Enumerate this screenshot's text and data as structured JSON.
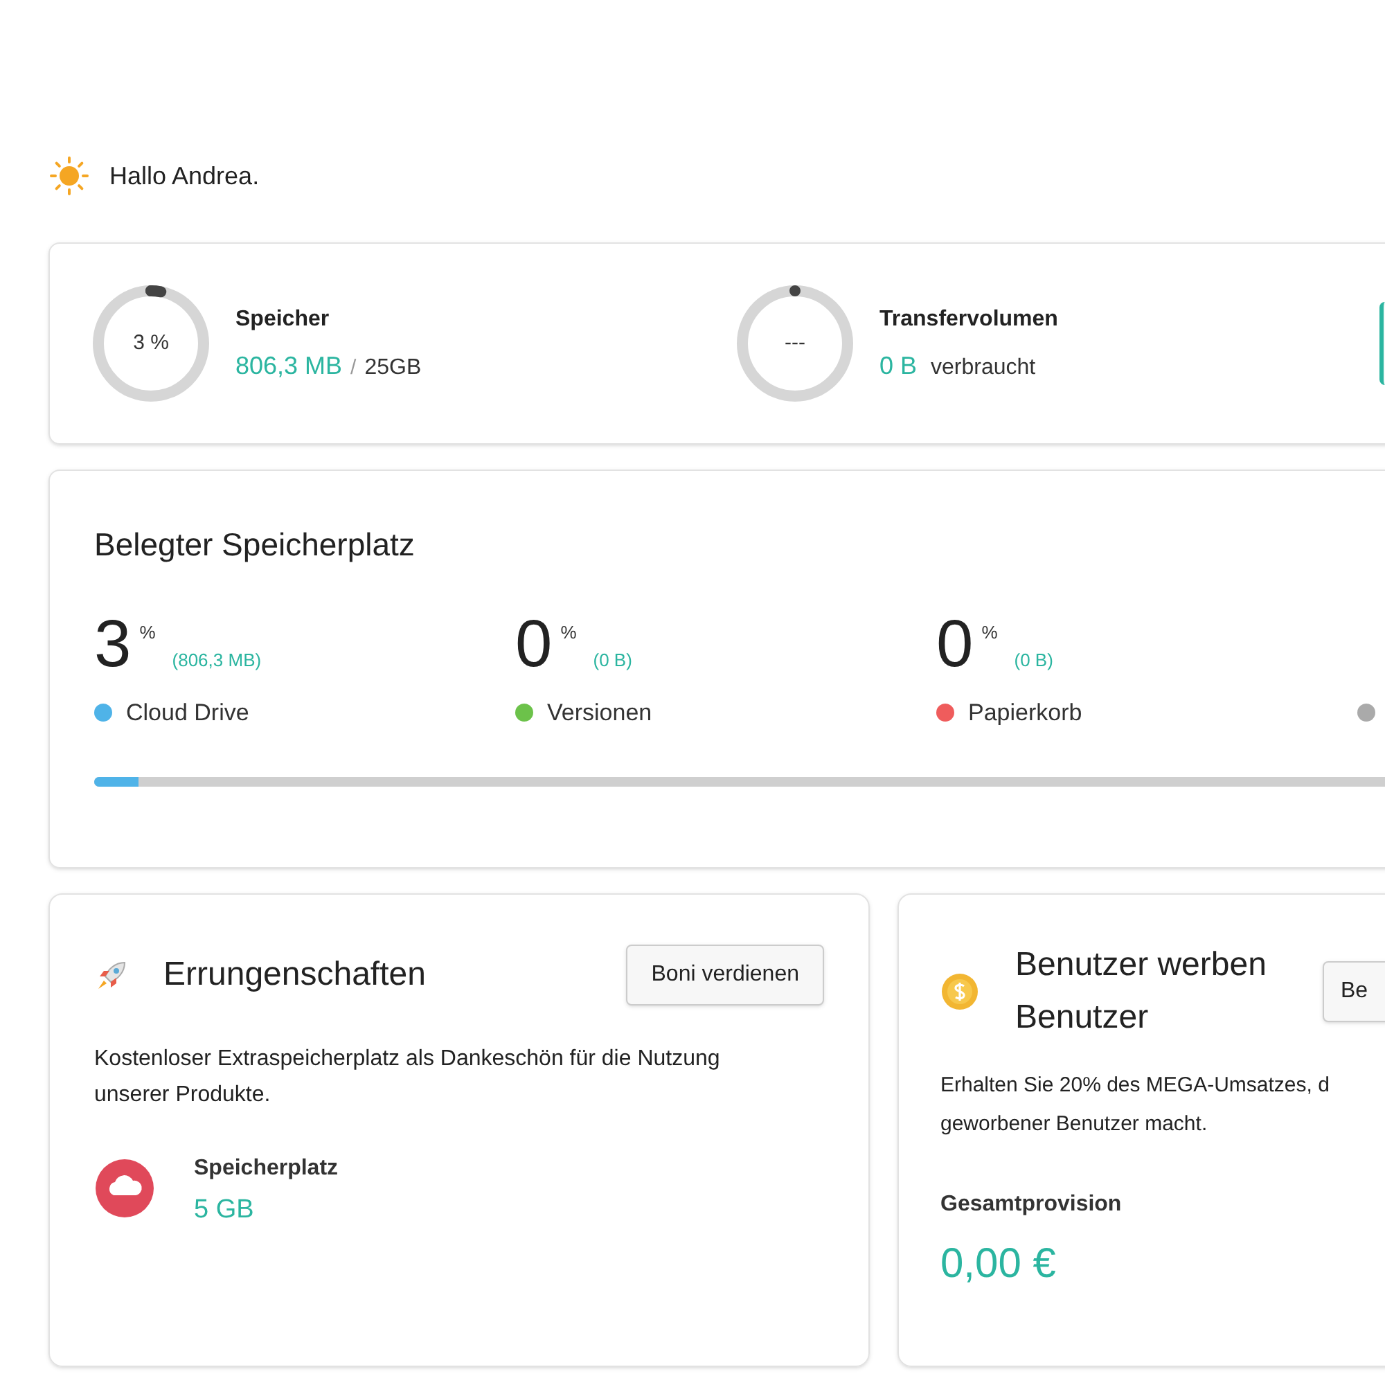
{
  "greeting": "Hallo Andrea.",
  "quota": [
    {
      "kind": "storage",
      "ring_text": "3 %",
      "level": 0.03,
      "title": "Speicher",
      "value": "806,3 MB",
      "separator": "/",
      "total": "25GB"
    },
    {
      "kind": "transfer",
      "ring_text": "---",
      "title": "Transfervolumen",
      "value": "0 B",
      "suffix": "verbraucht"
    }
  ],
  "usage": {
    "title": "Belegter Speicherplatz",
    "stats": [
      {
        "value": "3",
        "unit": "%",
        "detail": "(806,3 MB)",
        "label": "Cloud Drive",
        "color": "#4fb3e8",
        "level": 0.03
      },
      {
        "value": "0",
        "unit": "%",
        "detail": "(0 B)",
        "label": "Versionen",
        "color": "#6cc24a"
      },
      {
        "value": "0",
        "unit": "%",
        "detail": "(0 B)",
        "label": "Papierkorb",
        "color": "#ef5c5c"
      },
      {
        "color": "#aaaaaa"
      }
    ]
  },
  "achievements": {
    "title": "Errungenschaften",
    "button": "Boni verdienen",
    "text": "Kostenloser Extraspeicherplatz als Dankeschön für die Nutzung unserer Produkte.",
    "reward_label": "Speicherplatz",
    "reward_value": "5 GB"
  },
  "referral": {
    "title": "Benutzer werben Benutzer",
    "button": "Be",
    "text": "Erhalten Sie 20% des MEGA-Umsatzes, d geworbener Benutzer macht.",
    "total_label": "Gesamtprovision",
    "total_value": "0,00 €"
  }
}
